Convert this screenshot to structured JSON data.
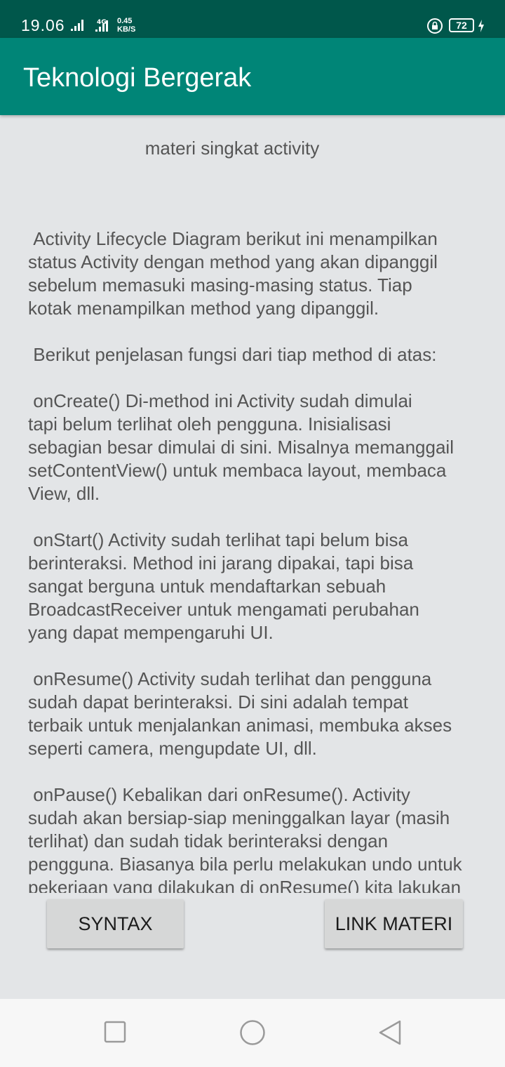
{
  "status_bar": {
    "time": "19.06",
    "net_speed_value": "0.45",
    "net_speed_unit": "KB/S",
    "network_type": "4G",
    "battery_level": "72",
    "icons": [
      "signal-icon",
      "signal-4g-icon",
      "lock-rotation-icon",
      "battery-icon",
      "charging-icon"
    ]
  },
  "app_bar": {
    "title": "Teknologi Bergerak"
  },
  "main": {
    "subtitle": "materi singkat activity",
    "paragraphs": [
      " Activity Lifecycle Diagram berikut ini menampilkan\nstatus Activity dengan method yang akan dipanggil\nsebelum memasuki masing-masing status. Tiap\nkotak menampilkan method yang dipanggil.",
      " Berikut penjelasan fungsi dari tiap method di atas:",
      " onCreate() Di-method ini Activity sudah dimulai\ntapi belum terlihat oleh pengguna. Inisialisasi\nsebagian besar dimulai di sini. Misalnya memanggail\nsetContentView() untuk membaca layout, membaca\nView, dll.",
      " onStart() Activity sudah terlihat tapi belum bisa\nberinteraksi. Method ini jarang dipakai, tapi bisa\nsangat berguna untuk mendaftarkan sebuah\nBroadcastReceiver untuk mengamati perubahan\nyang dapat mempengaruhi UI.",
      " onResume() Activity sudah terlihat dan pengguna\nsudah dapat berinteraksi. Di sini adalah tempat\nterbaik untuk menjalankan animasi, membuka akses\nseperti camera, mengupdate UI, dll.",
      " onPause() Kebalikan dari onResume(). Activity\nsudah akan bersiap-siap meninggalkan layar (masih\nterlihat) dan sudah tidak berinteraksi dengan\npengguna. Biasanya bila perlu melakukan undo untuk\npekerjaan yang dilakukan di onResume() kita lakukan"
    ]
  },
  "buttons": {
    "syntax": "SYNTAX",
    "link_materi": "LINK MATERI"
  },
  "nav_bar": {
    "icons": [
      "recent-apps-icon",
      "home-icon",
      "back-icon"
    ]
  },
  "colors": {
    "status_bar": "#00574b",
    "app_bar": "#008577",
    "background": "#e3e5e7",
    "text": "#555555",
    "button": "#d6d7d7"
  }
}
